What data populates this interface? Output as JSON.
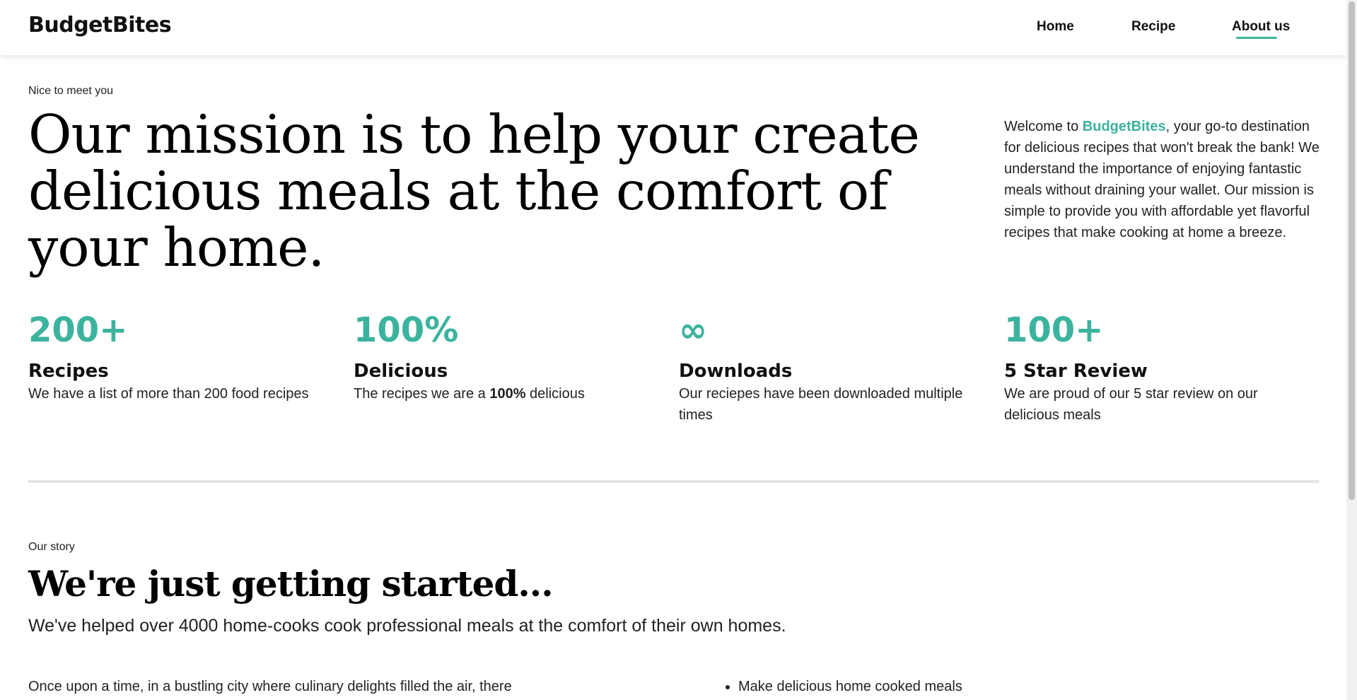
{
  "header": {
    "brand": "BudgetBites",
    "nav": {
      "home": "Home",
      "recipe": "Recipe",
      "about": "About us"
    },
    "active_nav": "about"
  },
  "hero": {
    "eyebrow": "Nice to meet you",
    "title": "Our mission is to help your create delicious meals at the comfort of your home.",
    "intro_prefix": "Welcome to ",
    "intro_brand": "BudgetBites",
    "intro_suffix": ", your go-to destination for delicious recipes that won't break the bank! We understand the importance of enjoying fantastic meals without draining your wallet. Our mission is simple to provide you with affordable yet flavorful recipes that make cooking at home a breeze."
  },
  "stats": [
    {
      "value": "200+",
      "label": "Recipes",
      "desc": "We have a list of more than 200 food recipes"
    },
    {
      "value": "100%",
      "label": "Delicious",
      "desc_prefix": "The recipes we are a ",
      "desc_bold": "100%",
      "desc_suffix": " delicious"
    },
    {
      "value": "∞",
      "label": "Downloads",
      "desc": "Our reciepes have been downloaded multiple times"
    },
    {
      "value": "100+",
      "label": "5 Star Review",
      "desc": "We are proud of our 5 star review on our delicious meals"
    }
  ],
  "story": {
    "eyebrow": "Our story",
    "title": "We're just getting started...",
    "subtitle": "We've helped over 4000 home-cooks cook professional meals at the comfort of their own homes.",
    "paragraph": "Once upon a time, in a bustling city where culinary delights filled the air, there",
    "list": [
      "Make delicious home cooked meals"
    ]
  },
  "colors": {
    "accent": "#3cb39e",
    "divider": "#e3e3e3"
  }
}
